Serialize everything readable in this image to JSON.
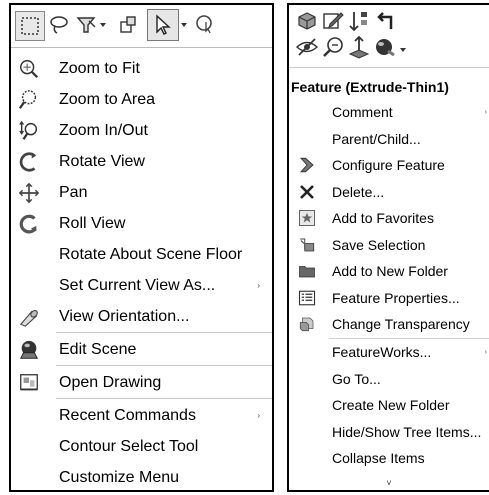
{
  "left_menu": {
    "toolbar": [
      {
        "icon": "box-select-icon"
      },
      {
        "icon": "lasso-select-icon"
      },
      {
        "icon": "selection-filter-icon"
      },
      {
        "icon": "select-other-icon"
      },
      {
        "icon": "select-arrow-icon"
      },
      {
        "icon": "magnifying-select-icon"
      }
    ],
    "items": [
      {
        "label": "Zoom to Fit",
        "icon": "zoom-to-fit-icon",
        "submenu": false
      },
      {
        "label": "Zoom to Area",
        "icon": "zoom-to-area-icon",
        "submenu": false
      },
      {
        "label": "Zoom In/Out",
        "icon": "zoom-in-out-icon",
        "submenu": false
      },
      {
        "label": "Rotate View",
        "icon": "rotate-view-icon",
        "submenu": false
      },
      {
        "label": "Pan",
        "icon": "pan-icon",
        "submenu": false
      },
      {
        "label": "Roll View",
        "icon": "roll-view-icon",
        "submenu": false
      },
      {
        "label": "Rotate About Scene Floor",
        "icon": "",
        "submenu": false
      },
      {
        "label": "Set Current View As...",
        "icon": "",
        "submenu": true
      },
      {
        "label": "View Orientation...",
        "icon": "view-orientation-icon",
        "submenu": false
      },
      {
        "label": "Edit Scene",
        "icon": "edit-scene-icon",
        "submenu": false
      },
      {
        "label": "Open Drawing",
        "icon": "open-drawing-icon",
        "submenu": false
      },
      {
        "label": "Recent Commands",
        "icon": "",
        "submenu": true
      },
      {
        "label": "Contour Select Tool",
        "icon": "",
        "submenu": false
      },
      {
        "label": "Customize Menu",
        "icon": "",
        "submenu": false
      }
    ],
    "submenu_arrow": "›"
  },
  "right_menu": {
    "header": "Feature (Extrude-Thin1)",
    "items": [
      {
        "label": "Comment",
        "icon": "",
        "submenu": true
      },
      {
        "label": "Parent/Child...",
        "icon": "",
        "submenu": false
      },
      {
        "label": "Configure Feature",
        "icon": "configure-feature-icon",
        "submenu": false
      },
      {
        "label": "Delete...",
        "icon": "delete-icon",
        "submenu": false
      },
      {
        "label": "Add to Favorites",
        "icon": "favorites-icon",
        "submenu": false
      },
      {
        "label": "Save Selection",
        "icon": "save-selection-icon",
        "submenu": false
      },
      {
        "label": "Add to New Folder",
        "icon": "folder-icon",
        "submenu": false
      },
      {
        "label": "Feature Properties...",
        "icon": "feature-properties-icon",
        "submenu": false
      },
      {
        "label": "Change Transparency",
        "icon": "transparency-icon",
        "submenu": false
      },
      {
        "label": "FeatureWorks...",
        "icon": "",
        "submenu": true
      },
      {
        "label": "Go To...",
        "icon": "",
        "submenu": false
      },
      {
        "label": "Create New Folder",
        "icon": "",
        "submenu": false
      },
      {
        "label": "Hide/Show Tree Items...",
        "icon": "",
        "submenu": false
      },
      {
        "label": "Collapse Items",
        "icon": "",
        "submenu": false
      }
    ],
    "more_arrow": "˅",
    "submenu_arrow": "›"
  }
}
